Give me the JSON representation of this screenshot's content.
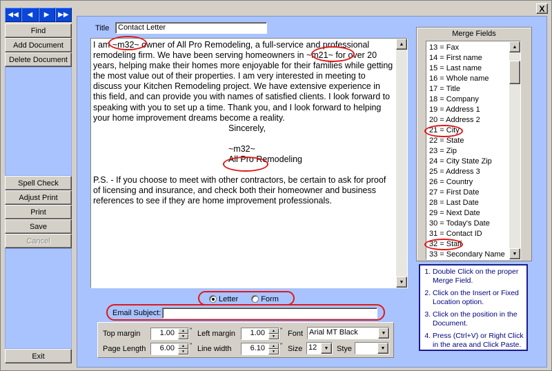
{
  "window": {
    "close_label": "X"
  },
  "nav": {
    "first": "◀◀",
    "prev": "◀",
    "next": "▶",
    "last": "▶▶"
  },
  "left_buttons": {
    "find": "Find",
    "add_document": "Add Document",
    "delete_document": "Delete Document",
    "spell_check": "Spell Check",
    "adjust_print": "Adjust Print",
    "print": "Print",
    "save": "Save",
    "cancel": "Cancel",
    "exit": "Exit"
  },
  "title_field": {
    "label": "Title",
    "value": "Contact Letter"
  },
  "document": {
    "paragraphs": [
      "I am ~m32~ owner of All Pro Remodeling, a full-service and professional remodeling firm. We have been serving homeowners in ~m21~ for over 20 years, helping make their homes more enjoyable for their families while getting the most value out of their properties. I am very interested in meeting to discuss your Kitchen Remodeling project.  We have extensive experience in this field, and can provide you with names of satisfied clients. I look forward to speaking with you to set up a time.  Thank you, and I look forward to helping your home improvement dreams become a reality."
    ],
    "closing": "Sincerely,",
    "signature_field": "~m32~",
    "company": "All Pro Remodeling",
    "ps": "P.S. - If you choose to meet with other contractors, be certain to ask for proof of licensing and insurance, and check both their homeowner and business references to see if they are home improvement professionals."
  },
  "merge_fields": {
    "title": "Merge Fields",
    "items": [
      "13 = Fax",
      "14 = First name",
      "15 = Last name",
      "16 = Whole name",
      "17 = Title",
      "18 = Company",
      "19 = Address 1",
      "20 = Address 2",
      "21 = City",
      "22 = State",
      "23 = Zip",
      "24 = City State Zip",
      "25 = Address 3",
      "26 = Country",
      "27 = First Date",
      "28 = Last Date",
      "29 = Next Date",
      "30 = Today's Date",
      "31 = Contact ID",
      "32 = Staff",
      "33 = Secondary Name"
    ]
  },
  "help": {
    "steps": [
      "Double Click on the proper Merge Field.",
      "Click on the Insert or Fixed Location option.",
      "Click on the position in the Document.",
      "Press (Ctrl+V) or Right Click in the area and Click Paste."
    ]
  },
  "doc_type": {
    "letter": "Letter",
    "form": "Form",
    "selected": "Letter"
  },
  "email_subject": {
    "label": "Email Subject:",
    "value": ""
  },
  "print_settings": {
    "top_margin_label": "Top margin",
    "top_margin": "1.00",
    "left_margin_label": "Left margin",
    "left_margin": "1.00",
    "page_length_label": "Page Length",
    "page_length": "6.00",
    "line_width_label": "Line width",
    "line_width": "6.10",
    "font_label": "Font",
    "font": "Arial MT Black",
    "size_label": "Size",
    "size": "12",
    "style_label": "Stye",
    "style": "",
    "inch_mark": "\""
  },
  "annotation_color": "#e01818",
  "nav_color": "#0a46d8",
  "panel_color": "#a9c3ff"
}
